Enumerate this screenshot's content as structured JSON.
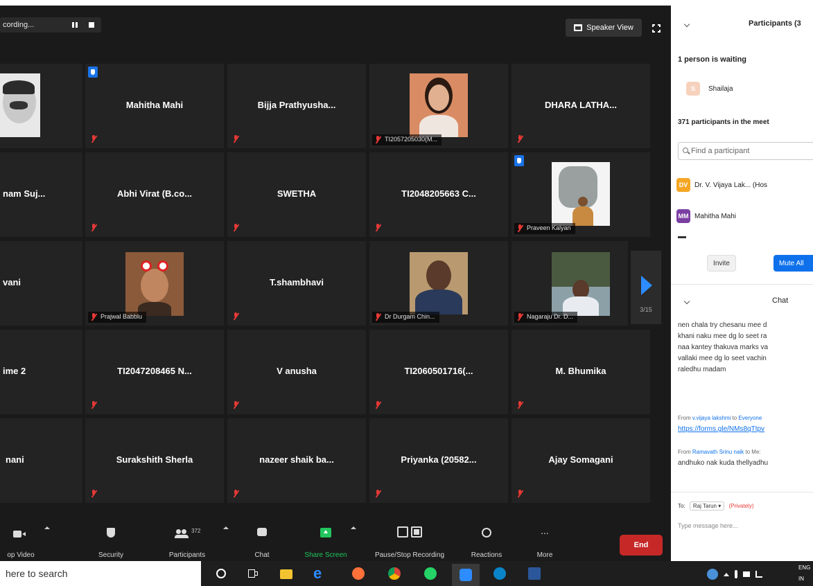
{
  "topbar": {
    "recording_text": "cording...",
    "speaker_view_label": "Speaker View"
  },
  "tiles": {
    "t1_1": {
      "label": ""
    },
    "t1_2": {
      "name": "Mahitha Mahi"
    },
    "t1_3": {
      "name": "Bijja Prathyusha..."
    },
    "t1_4": {
      "label": "TI2057205030(M..."
    },
    "t1_5": {
      "name": "DHARA LATHA..."
    },
    "t2_1": {
      "name": "nam Suj..."
    },
    "t2_2": {
      "name": "Abhi Virat (B.co..."
    },
    "t2_3": {
      "name": "SWETHA"
    },
    "t2_4": {
      "name": "TI2048205663 C..."
    },
    "t2_5": {
      "label": "Praveen Kalyan"
    },
    "t3_1": {
      "name": "vani"
    },
    "t3_2": {
      "label": "Prajwal Babblu"
    },
    "t3_3": {
      "name": "T.shambhavi"
    },
    "t3_4": {
      "label": "Dr Durgam Chin..."
    },
    "t3_5": {
      "label": "Nagaraju Dr. D..."
    },
    "t4_1": {
      "name": "ime 2"
    },
    "t4_2": {
      "name": "TI2047208465 N..."
    },
    "t4_3": {
      "name": "V anusha"
    },
    "t4_4": {
      "name": "TI2060501716(..."
    },
    "t4_5": {
      "name": "M. Bhumika"
    },
    "t5_1": {
      "name": "nani"
    },
    "t5_2": {
      "name": "Surakshith Sherla"
    },
    "t5_3": {
      "name": "nazeer shaik ba..."
    },
    "t5_4": {
      "name": "Priyanka (20582..."
    },
    "t5_5": {
      "name": "Ajay Somagani"
    }
  },
  "pagination": {
    "page": "3/15"
  },
  "toolbar": {
    "video": "op Video",
    "security": "Security",
    "participants": "Participants",
    "participants_count": "372",
    "chat": "Chat",
    "share": "Share Screen",
    "record": "Pause/Stop Recording",
    "reactions": "Reactions",
    "more": "More",
    "more_dots": "...",
    "end": "End"
  },
  "panel": {
    "title": "Participants (3",
    "waiting_header": "1 person is waiting",
    "waiting": [
      {
        "initial": "S",
        "name": "Shailaja"
      }
    ],
    "in_meeting_header": "371 participants in the meet",
    "search_placeholder": "Find a participant",
    "participants": [
      {
        "initials": "DV",
        "name": "Dr. V. Vijaya Lak... (Hos",
        "color": "#f5a623"
      },
      {
        "initials": "MM",
        "name": "Mahitha Mahi",
        "color": "#7b3fa3"
      }
    ],
    "invite": "Invite",
    "mute_all": "Mute All",
    "chat_title": "Chat",
    "chat_lines": [
      "nen chala try chesanu mee d",
      "khani naku mee dg lo seet ra",
      "naa kantey thakuva marks va",
      "vallaki mee dg lo seet vachin",
      "raledhu madam"
    ],
    "msg2": {
      "from": "From",
      "sender": "v.vijaya lakshmi",
      "to": "to",
      "recipient": "Everyone",
      "link": "https://forms.gle/NMs8qTtpv"
    },
    "msg3": {
      "from": "From",
      "sender": "Ramavath Srinu naik",
      "to": "to Me:",
      "text": "andhuko nak kuda thellyadhu"
    },
    "to_label": "To:",
    "to_value": "Raj Tarun",
    "privately": "(Privately)",
    "compose_placeholder": "Type message here..."
  },
  "taskbar": {
    "search_text": "here to search",
    "lang": "ENG",
    "lang2": "IN"
  },
  "colors": {
    "zoom_blue": "#2d8cff",
    "end_red": "#c62828",
    "mute_red": "#e53935",
    "share_green": "#22c55e"
  }
}
